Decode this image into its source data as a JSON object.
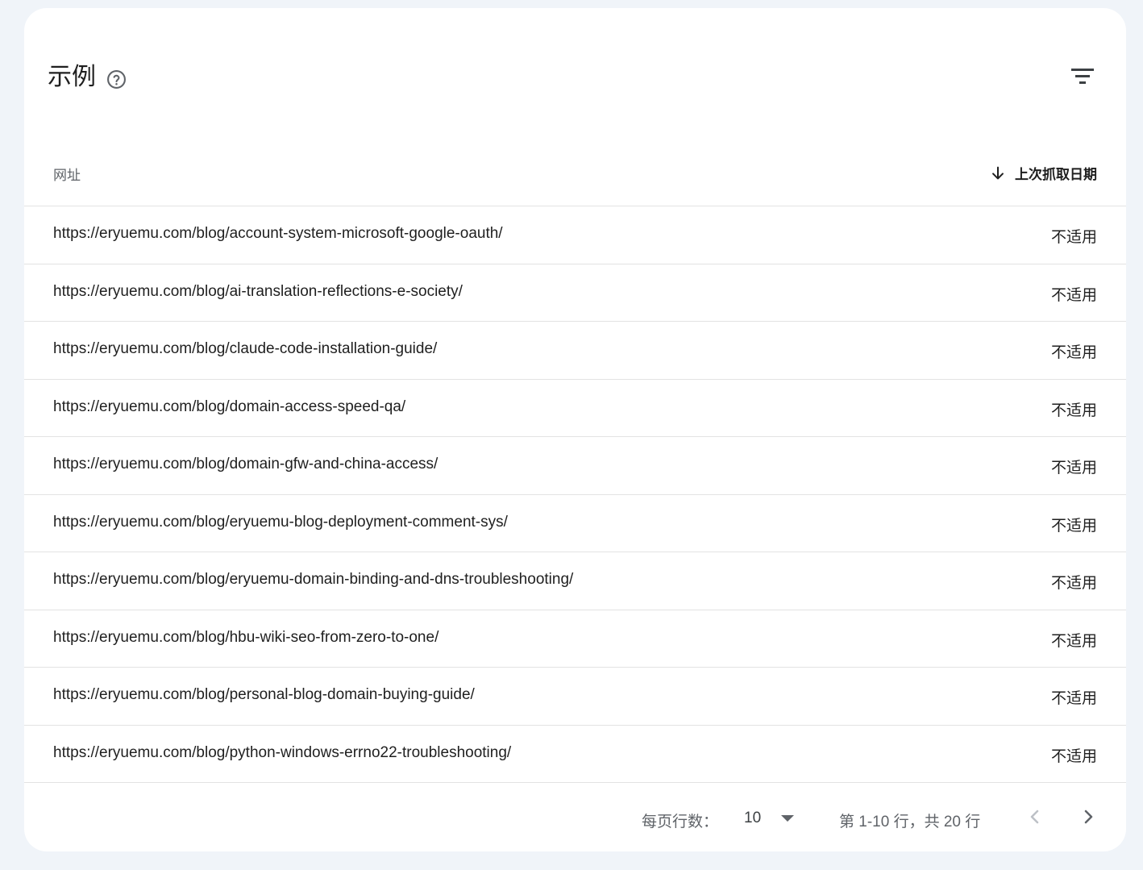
{
  "card": {
    "title": "示例"
  },
  "table": {
    "columns": {
      "url": "网址",
      "last_crawled": "上次抓取日期"
    },
    "rows": [
      {
        "url": "https://eryuemu.com/blog/account-system-microsoft-google-oauth/",
        "date": "不适用"
      },
      {
        "url": "https://eryuemu.com/blog/ai-translation-reflections-e-society/",
        "date": "不适用"
      },
      {
        "url": "https://eryuemu.com/blog/claude-code-installation-guide/",
        "date": "不适用"
      },
      {
        "url": "https://eryuemu.com/blog/domain-access-speed-qa/",
        "date": "不适用"
      },
      {
        "url": "https://eryuemu.com/blog/domain-gfw-and-china-access/",
        "date": "不适用"
      },
      {
        "url": "https://eryuemu.com/blog/eryuemu-blog-deployment-comment-sys/",
        "date": "不适用"
      },
      {
        "url": "https://eryuemu.com/blog/eryuemu-domain-binding-and-dns-troubleshooting/",
        "date": "不适用"
      },
      {
        "url": "https://eryuemu.com/blog/hbu-wiki-seo-from-zero-to-one/",
        "date": "不适用"
      },
      {
        "url": "https://eryuemu.com/blog/personal-blog-domain-buying-guide/",
        "date": "不适用"
      },
      {
        "url": "https://eryuemu.com/blog/python-windows-errno22-troubleshooting/",
        "date": "不适用"
      }
    ]
  },
  "pagination": {
    "rows_per_page_label": "每页行数：",
    "rows_per_page_value": "10",
    "range_text": "第 1-10 行，共 20 行"
  },
  "icons": {
    "help": "help-circle-icon",
    "filter": "filter-icon",
    "sort": "arrow-down-icon",
    "dropdown": "triangle-down-icon",
    "prev": "chevron-left-icon",
    "next": "chevron-right-icon"
  },
  "colors": {
    "background": "#f0f4f9",
    "card": "#ffffff",
    "divider": "#e3e3e3",
    "secondary_text": "#5f6368",
    "disabled_icon": "#bdc1c6"
  }
}
